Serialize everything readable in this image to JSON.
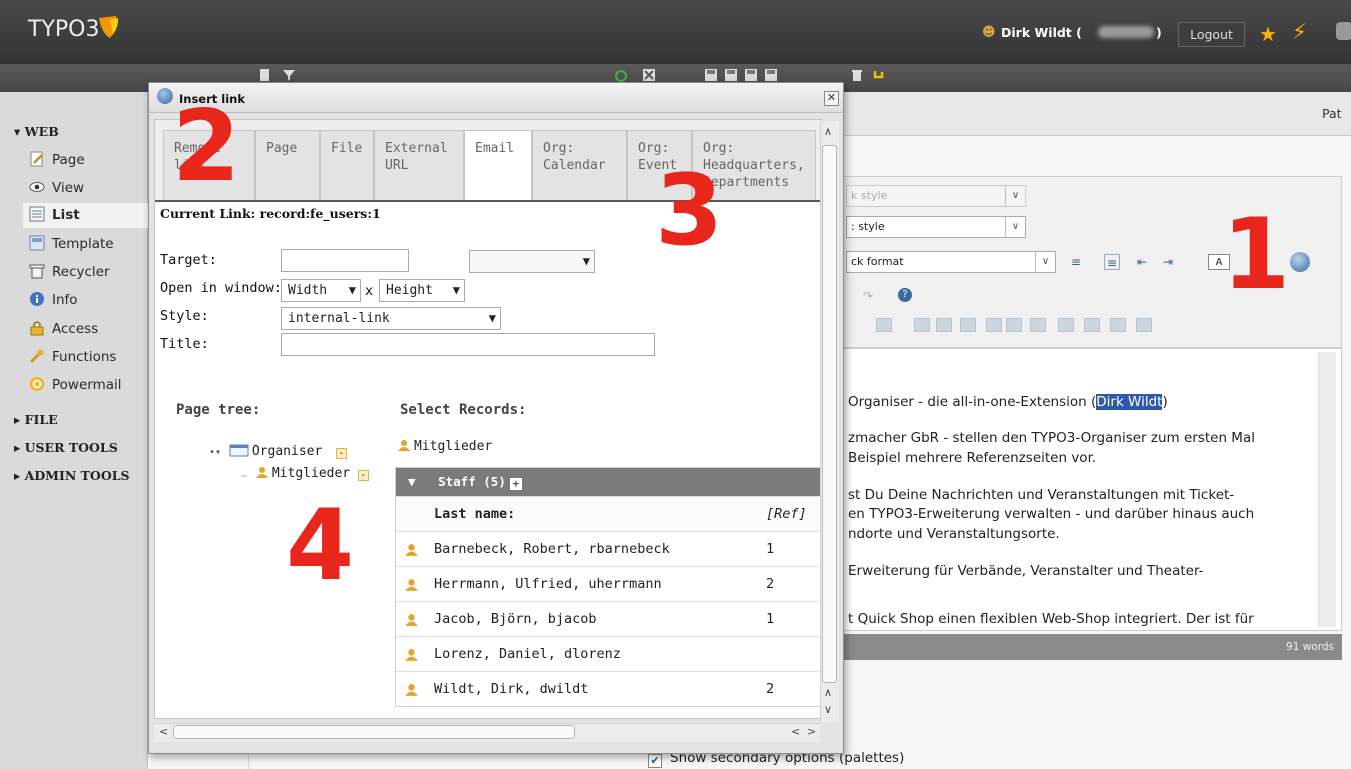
{
  "topbar": {
    "logo_text": "TYPO3",
    "user_name": "Dirk Wildt (",
    "user_name_close": ")",
    "logout_label": "Logout"
  },
  "module_menu": {
    "sections": [
      {
        "label": "▾ WEB"
      },
      {
        "label": "▸ FILE"
      },
      {
        "label": "▸ USER TOOLS"
      },
      {
        "label": "▸ ADMIN TOOLS"
      }
    ],
    "items": [
      {
        "label": "Page",
        "icon": "page-edit-icon"
      },
      {
        "label": "View",
        "icon": "eye-icon"
      },
      {
        "label": "List",
        "icon": "list-icon"
      },
      {
        "label": "Template",
        "icon": "template-icon"
      },
      {
        "label": "Recycler",
        "icon": "recycler-icon"
      },
      {
        "label": "Info",
        "icon": "info-icon"
      },
      {
        "label": "Access",
        "icon": "lock-icon"
      },
      {
        "label": "Functions",
        "icon": "wrench-icon"
      },
      {
        "label": "Powermail",
        "icon": "powermail-icon"
      }
    ]
  },
  "docheader": {
    "path_label": "Pat"
  },
  "rte": {
    "block_style": "k style",
    "text_style": ": style",
    "block_format": "ck format",
    "lines": [
      "Organiser - die all-in-one-Extension (",
      "Dirk Wildt",
      ")",
      "zmacher GbR - stellen den TYPO3-Organiser zum ersten Mal",
      "Beispiel mehrere Referenzseiten vor.",
      "st Du Deine Nachrichten und Veranstaltungen mit Ticket-",
      "en TYPO3-Erweiterung verwalten - und darüber hinaus auch",
      "ndorte und Veranstaltungsorte.",
      "Erweiterung für Verbände, Veranstalter und Theater-",
      "t Quick Shop einen flexiblen Web-Shop integriert. Der ist für"
    ],
    "word_count": "91 words"
  },
  "palette_option": "Show secondary options (palettes)",
  "annotations": [
    "1",
    "2",
    "3",
    "4"
  ],
  "dialog": {
    "title": "Insert link",
    "tabs": [
      {
        "label": "Remove link",
        "active": false
      },
      {
        "label": "Page",
        "active": false
      },
      {
        "label": "File",
        "active": false
      },
      {
        "label": "External URL",
        "active": false
      },
      {
        "label": "Email",
        "active": true
      },
      {
        "label": "Org: Calendar",
        "active": false
      },
      {
        "label": "Org: Event",
        "active": false
      },
      {
        "label": "Org: Headquarters, Departments",
        "active": false
      }
    ],
    "current_link": "Current Link: record:fe_users:1",
    "form": {
      "target_label": "Target:",
      "target_value": "",
      "target_select": "",
      "open_in_window_label": "Open in window:",
      "width_select": "Width",
      "x_label": "x",
      "height_select": "Height",
      "style_label": "Style:",
      "style_value": "internal-link",
      "title_label": "Title:",
      "title_value": ""
    },
    "page_tree": {
      "heading": "Page tree:",
      "root": "Organiser",
      "child": "Mitglieder"
    },
    "select_records": {
      "heading": "Select Records:",
      "page": "Mitglieder",
      "table_title": "Staff (5)",
      "col_last_name": "Last name:",
      "col_ref": "[Ref]",
      "rows": [
        {
          "name": "Barnebeck, Robert, rbarnebeck",
          "ref": "1"
        },
        {
          "name": "Herrmann, Ulfried, uherrmann",
          "ref": "2"
        },
        {
          "name": "Jacob, Björn, bjacob",
          "ref": "1"
        },
        {
          "name": "Lorenz, Daniel, dlorenz",
          "ref": ""
        },
        {
          "name": "Wildt, Dirk, dwildt",
          "ref": "2"
        }
      ]
    }
  },
  "colors": {
    "accent_red": "#e8261c",
    "topbar": "#3a3a3a",
    "selection": "#2f5aa9"
  }
}
